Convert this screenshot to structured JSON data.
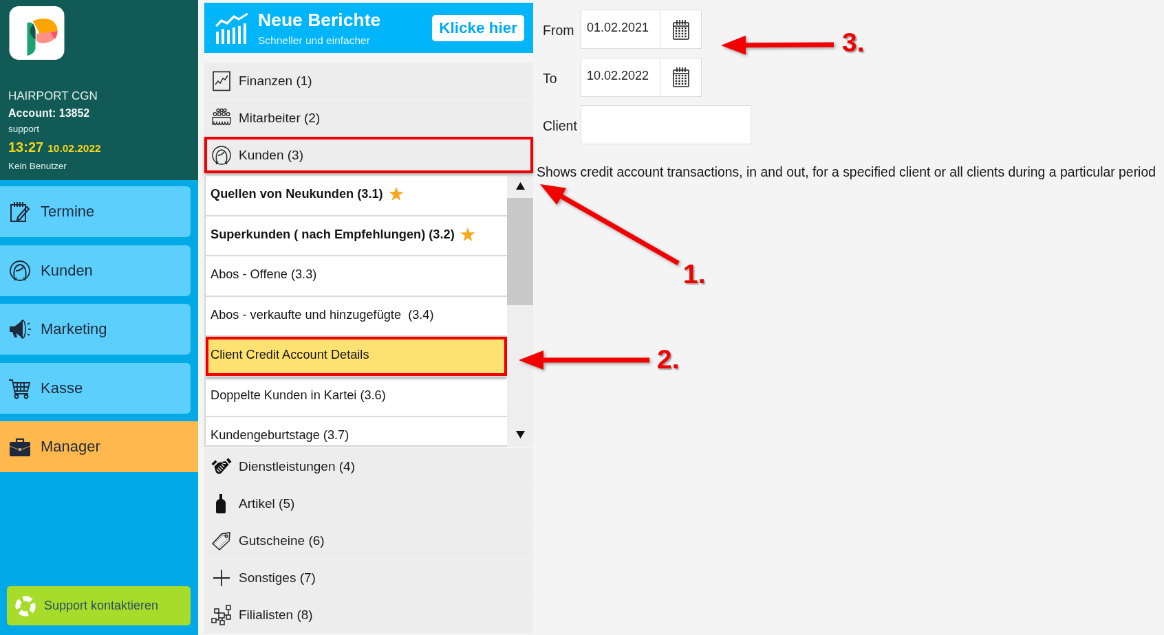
{
  "sidebar": {
    "salon": "HAIRPORT CGN",
    "account": "Account: 13852",
    "user": "support",
    "time": "13:27",
    "date": "10.02.2022",
    "operator": "Kein Benutzer",
    "nav": [
      {
        "label": "Termine",
        "selected": false
      },
      {
        "label": "Kunden",
        "selected": false
      },
      {
        "label": "Marketing",
        "selected": false
      },
      {
        "label": "Kasse",
        "selected": false
      },
      {
        "label": "Manager",
        "selected": true
      }
    ],
    "support_button": "Support kontaktieren"
  },
  "banner": {
    "title": "Neue Berichte",
    "subtitle": "Schneller und einfacher",
    "button": "Klicke hier"
  },
  "categories": [
    {
      "label": "Finanzen (1)",
      "marked": false
    },
    {
      "label": "Mitarbeiter (2)",
      "marked": false
    },
    {
      "label": "Kunden (3)",
      "marked": true,
      "reports": [
        {
          "label": "Quellen von Neukunden (3.1)",
          "starred": true,
          "selected": false,
          "marked": false
        },
        {
          "label": "Superkunden ( nach Empfehlungen) (3.2)",
          "starred": true,
          "selected": false,
          "marked": false
        },
        {
          "label": "Abos - Offene (3.3)",
          "starred": false,
          "selected": false,
          "marked": false
        },
        {
          "label": "Abos - verkaufte und hinzugefügte  (3.4)",
          "starred": false,
          "selected": false,
          "marked": false
        },
        {
          "label": "Client Credit Account Details",
          "starred": false,
          "selected": true,
          "marked": true
        },
        {
          "label": "Doppelte Kunden in Kartei (3.6)",
          "starred": false,
          "selected": false,
          "marked": false
        },
        {
          "label": "Kundengeburtstage (3.7)",
          "starred": false,
          "selected": false,
          "marked": false
        }
      ]
    },
    {
      "label": "Dienstleistungen (4)",
      "marked": false
    },
    {
      "label": "Artikel (5)",
      "marked": false
    },
    {
      "label": "Gutscheine (6)",
      "marked": false
    },
    {
      "label": "Sonstiges (7)",
      "marked": false
    },
    {
      "label": "Filialisten (8)",
      "marked": false
    }
  ],
  "report_form": {
    "from": {
      "label": "From",
      "value": "01.02.2021"
    },
    "to": {
      "label": "To",
      "value": "10.02.2022"
    },
    "client": {
      "label": "Client"
    },
    "description": "Shows credit account transactions, in and out, for a specified client or all clients during a particular period"
  },
  "annotations": [
    {
      "label": "1."
    },
    {
      "label": "2."
    },
    {
      "label": "3."
    }
  ]
}
